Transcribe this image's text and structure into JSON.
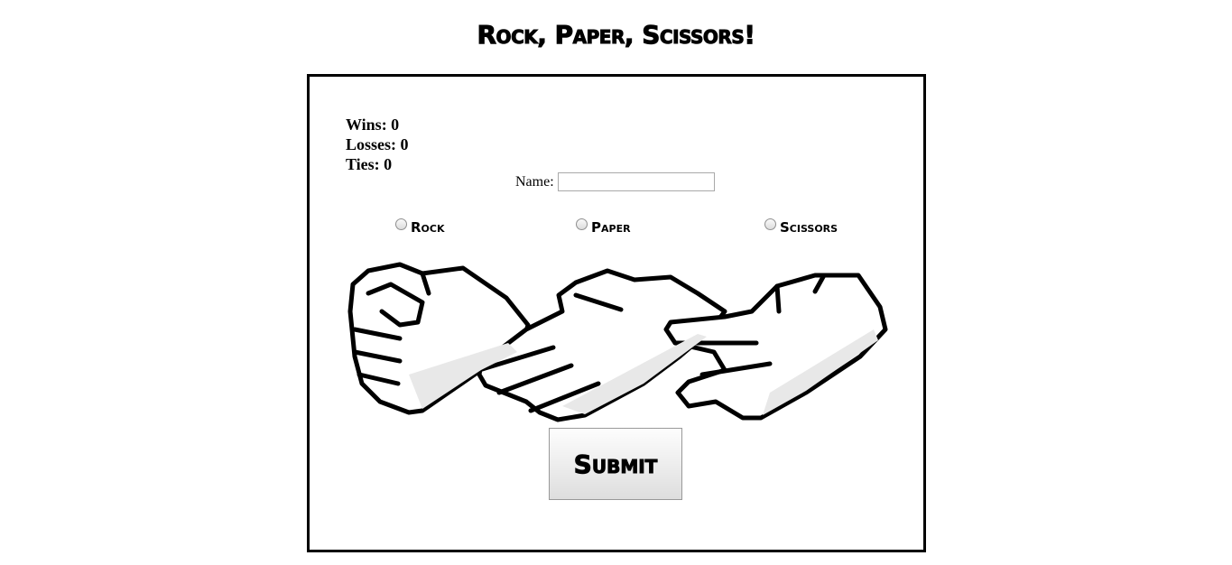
{
  "title": "Rock, Paper, Scissors!",
  "scores": {
    "wins_label": "Wins: 0",
    "losses_label": "Losses: 0",
    "ties_label": "Ties: 0"
  },
  "name_field": {
    "label": "Name:",
    "value": ""
  },
  "choices": [
    {
      "label": "Rock",
      "checked": false
    },
    {
      "label": "Paper",
      "checked": false
    },
    {
      "label": "Scissors",
      "checked": false
    }
  ],
  "submit_label": "Submit",
  "illustration_icon": "rock-paper-scissors-hands-icon"
}
